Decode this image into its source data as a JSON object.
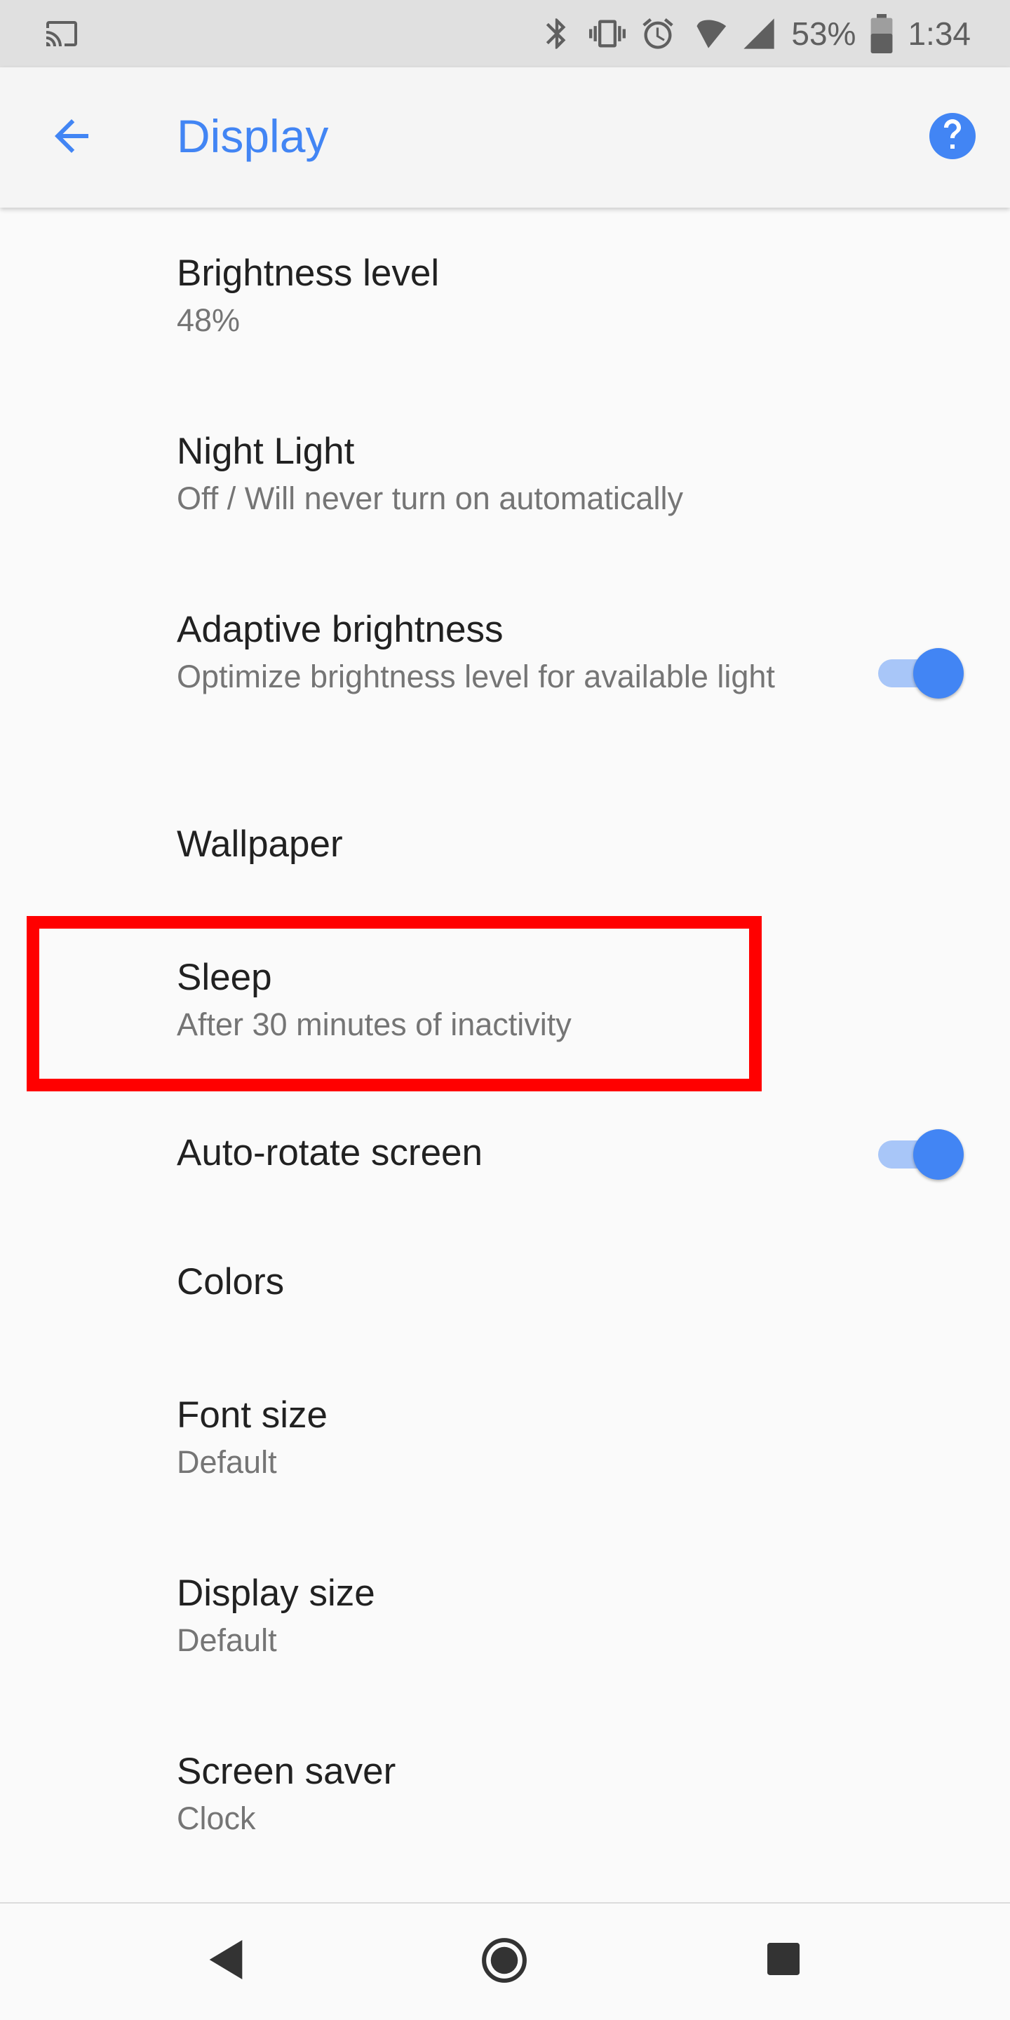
{
  "status_bar": {
    "battery_percent": "53%",
    "time": "1:34",
    "icons": [
      "cast-icon",
      "bluetooth-icon",
      "vibrate-icon",
      "alarm-icon",
      "wifi-icon",
      "signal-icon",
      "battery-icon"
    ]
  },
  "app_bar": {
    "title": "Display",
    "back_icon": "arrow-back-icon",
    "help_icon": "help-icon"
  },
  "colors": {
    "accent": "#4285f4",
    "highlight": "#ff0000"
  },
  "settings": {
    "brightness_level": {
      "title": "Brightness level",
      "summary": "48%"
    },
    "night_light": {
      "title": "Night Light",
      "summary": "Off / Will never turn on automatically"
    },
    "adaptive_brightness": {
      "title": "Adaptive brightness",
      "summary": "Optimize brightness level for available light",
      "enabled": true
    },
    "wallpaper": {
      "title": "Wallpaper"
    },
    "sleep": {
      "title": "Sleep",
      "summary": "After 30 minutes of inactivity"
    },
    "auto_rotate": {
      "title": "Auto-rotate screen",
      "enabled": true
    },
    "colors": {
      "title": "Colors"
    },
    "font_size": {
      "title": "Font size",
      "summary": "Default"
    },
    "display_size": {
      "title": "Display size",
      "summary": "Default"
    },
    "screen_saver": {
      "title": "Screen saver",
      "summary": "Clock"
    }
  },
  "nav_bar": {
    "icons": [
      "nav-back-icon",
      "nav-home-icon",
      "nav-recents-icon"
    ]
  }
}
